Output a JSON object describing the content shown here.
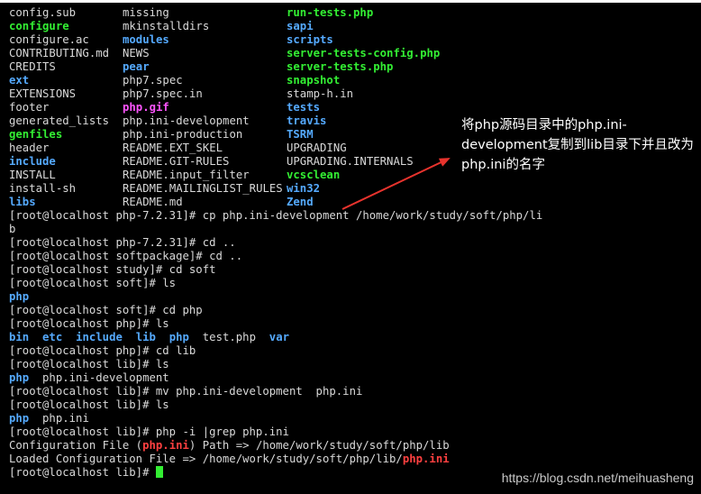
{
  "listing": [
    [
      {
        "t": "config.sub",
        "c": ""
      },
      {
        "t": "missing",
        "c": ""
      },
      {
        "t": "run-tests.php",
        "c": "green"
      }
    ],
    [
      {
        "t": "configure",
        "c": "green"
      },
      {
        "t": "mkinstalldirs",
        "c": ""
      },
      {
        "t": "sapi",
        "c": "blue"
      }
    ],
    [
      {
        "t": "configure.ac",
        "c": ""
      },
      {
        "t": "modules",
        "c": "blue"
      },
      {
        "t": "scripts",
        "c": "blue"
      }
    ],
    [
      {
        "t": "CONTRIBUTING.md",
        "c": ""
      },
      {
        "t": "NEWS",
        "c": ""
      },
      {
        "t": "server-tests-config.php",
        "c": "green"
      }
    ],
    [
      {
        "t": "CREDITS",
        "c": ""
      },
      {
        "t": "pear",
        "c": "blue"
      },
      {
        "t": "server-tests.php",
        "c": "green"
      }
    ],
    [
      {
        "t": "ext",
        "c": "blue"
      },
      {
        "t": "php7.spec",
        "c": ""
      },
      {
        "t": "snapshot",
        "c": "green"
      }
    ],
    [
      {
        "t": "EXTENSIONS",
        "c": ""
      },
      {
        "t": "php7.spec.in",
        "c": ""
      },
      {
        "t": "stamp-h.in",
        "c": ""
      }
    ],
    [
      {
        "t": "footer",
        "c": ""
      },
      {
        "t": "php.gif",
        "c": "magenta"
      },
      {
        "t": "tests",
        "c": "blue"
      }
    ],
    [
      {
        "t": "generated_lists",
        "c": ""
      },
      {
        "t": "php.ini-development",
        "c": ""
      },
      {
        "t": "travis",
        "c": "blue"
      }
    ],
    [
      {
        "t": "genfiles",
        "c": "green"
      },
      {
        "t": "php.ini-production",
        "c": ""
      },
      {
        "t": "TSRM",
        "c": "blue"
      }
    ],
    [
      {
        "t": "header",
        "c": ""
      },
      {
        "t": "README.EXT_SKEL",
        "c": ""
      },
      {
        "t": "UPGRADING",
        "c": ""
      }
    ],
    [
      {
        "t": "include",
        "c": "blue"
      },
      {
        "t": "README.GIT-RULES",
        "c": ""
      },
      {
        "t": "UPGRADING.INTERNALS",
        "c": ""
      }
    ],
    [
      {
        "t": "INSTALL",
        "c": ""
      },
      {
        "t": "README.input_filter",
        "c": ""
      },
      {
        "t": "vcsclean",
        "c": "green"
      }
    ],
    [
      {
        "t": "install-sh",
        "c": ""
      },
      {
        "t": "README.MAILINGLIST_RULES",
        "c": ""
      },
      {
        "t": "win32",
        "c": "blue"
      }
    ],
    [
      {
        "t": "libs",
        "c": "blue"
      },
      {
        "t": "README.md",
        "c": ""
      },
      {
        "t": "Zend",
        "c": "blue"
      }
    ]
  ],
  "session": [
    [
      {
        "t": "[root@localhost php-7.2.31]# cp php.ini-development /home/work/study/soft/php/li",
        "c": ""
      }
    ],
    [
      {
        "t": "b",
        "c": ""
      }
    ],
    [
      {
        "t": "[root@localhost php-7.2.31]# cd ..",
        "c": ""
      }
    ],
    [
      {
        "t": "[root@localhost softpackage]# cd ..",
        "c": ""
      }
    ],
    [
      {
        "t": "[root@localhost study]# cd soft",
        "c": ""
      }
    ],
    [
      {
        "t": "[root@localhost soft]# ls",
        "c": ""
      }
    ],
    [
      {
        "t": "php",
        "c": "blue"
      }
    ],
    [
      {
        "t": "[root@localhost soft]# cd php",
        "c": ""
      }
    ],
    [
      {
        "t": "[root@localhost php]# ls",
        "c": ""
      }
    ],
    [
      {
        "t": "bin",
        "c": "blue"
      },
      {
        "t": "  ",
        "c": ""
      },
      {
        "t": "etc",
        "c": "blue"
      },
      {
        "t": "  ",
        "c": ""
      },
      {
        "t": "include",
        "c": "blue"
      },
      {
        "t": "  ",
        "c": ""
      },
      {
        "t": "lib",
        "c": "blue"
      },
      {
        "t": "  ",
        "c": ""
      },
      {
        "t": "php",
        "c": "blue"
      },
      {
        "t": "  test.php  ",
        "c": ""
      },
      {
        "t": "var",
        "c": "blue"
      }
    ],
    [
      {
        "t": "[root@localhost php]# cd lib",
        "c": ""
      }
    ],
    [
      {
        "t": "[root@localhost lib]# ls",
        "c": ""
      }
    ],
    [
      {
        "t": "php",
        "c": "blue"
      },
      {
        "t": "  php.ini-development",
        "c": ""
      }
    ],
    [
      {
        "t": "[root@localhost lib]# mv php.ini-development  php.ini",
        "c": ""
      }
    ],
    [
      {
        "t": "[root@localhost lib]# ls",
        "c": ""
      }
    ],
    [
      {
        "t": "php",
        "c": "blue"
      },
      {
        "t": "  php.ini",
        "c": ""
      }
    ],
    [
      {
        "t": "[root@localhost lib]# php -i |grep php.ini",
        "c": ""
      }
    ],
    [
      {
        "t": "Configuration File (",
        "c": ""
      },
      {
        "t": "php.ini",
        "c": "red"
      },
      {
        "t": ") Path => /home/work/study/soft/php/lib",
        "c": ""
      }
    ],
    [
      {
        "t": "Loaded Configuration File => /home/work/study/soft/php/lib/",
        "c": ""
      },
      {
        "t": "php.ini",
        "c": "red"
      }
    ]
  ],
  "prompt": {
    "text": "[root@localhost lib]# "
  },
  "annotation": {
    "text": "将php源码目录中的php.ini-development复制到lib目录下并且改为php.ini的名字",
    "arrow_color": "#e8332d"
  },
  "watermark": {
    "text": "https://blog.csdn.net/meihuasheng"
  },
  "colors": {
    "background": "#000000",
    "text": "#d9d9d9",
    "directory": "#55aaff",
    "executable": "#33ee33",
    "image": "#ff55ff",
    "match": "#ff4040",
    "cursor": "#33ee33"
  }
}
